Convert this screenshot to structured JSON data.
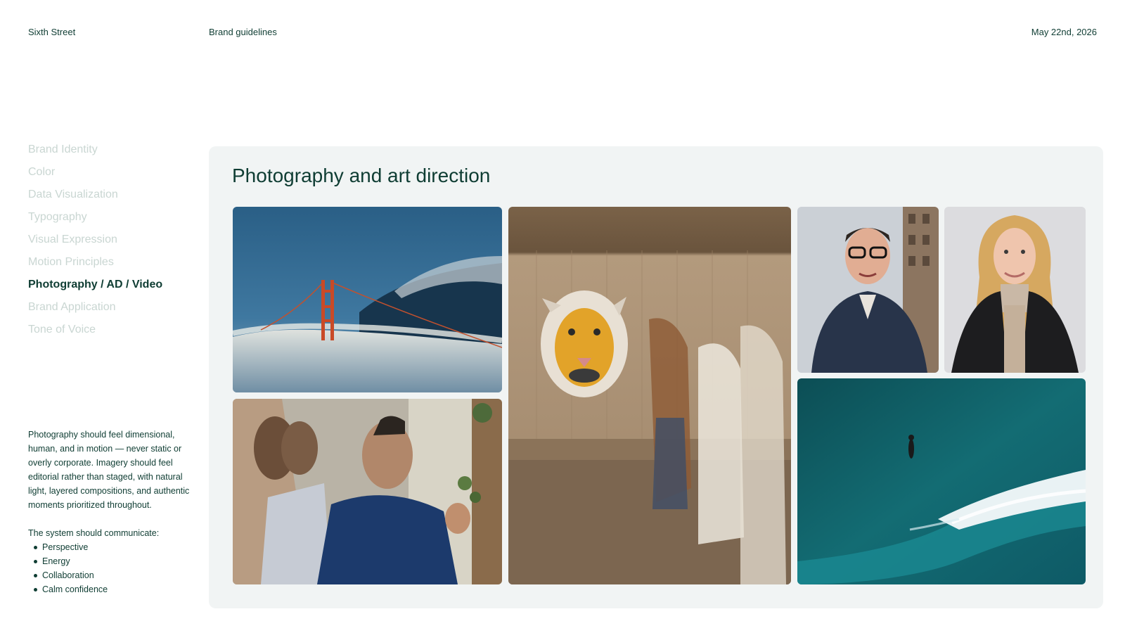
{
  "header": {
    "brand": "Sixth Street",
    "document": "Brand guidelines",
    "date": "May 22nd, 2026"
  },
  "nav": {
    "items": [
      {
        "label": "Brand Identity",
        "active": false
      },
      {
        "label": "Color",
        "active": false
      },
      {
        "label": "Data Visualization",
        "active": false
      },
      {
        "label": "Typography",
        "active": false
      },
      {
        "label": "Visual Expression",
        "active": false
      },
      {
        "label": "Motion Principles",
        "active": false
      },
      {
        "label": "Photography / AD / Video",
        "active": true
      },
      {
        "label": "Brand Application",
        "active": false
      },
      {
        "label": "Tone of Voice",
        "active": false
      }
    ]
  },
  "sidebar": {
    "description": "Photography should feel dimensional, human, and in motion — never static or overly corporate. Imagery should feel editorial rather than staged, with natural light, layered compositions, and authentic moments prioritized throughout.",
    "list_heading": "The system should communicate:",
    "list": [
      "Perspective",
      "Energy",
      "Collaboration",
      "Calm confidence"
    ]
  },
  "main": {
    "title": "Photography and art direction"
  },
  "colors": {
    "primary": "#0f3d33",
    "muted_nav": "#c9d6d2",
    "panel_bg": "#f1f4f4",
    "background": "#ffffff"
  }
}
